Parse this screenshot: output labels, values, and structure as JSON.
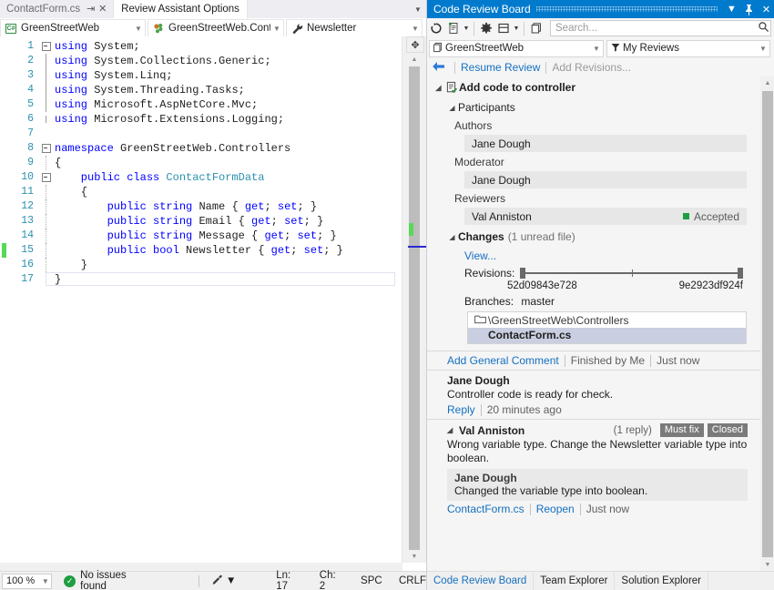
{
  "editor": {
    "tabs": [
      {
        "label": "ContactForm.cs",
        "active": true,
        "pin_icon": "pin-icon",
        "close_icon": "close-icon"
      },
      {
        "label": "Review Assistant Options",
        "active": false
      }
    ],
    "tabstrip_overflow_icon": "chevron-down-icon",
    "navbar": {
      "project": {
        "icon": "csharp-project-icon",
        "badge": "C#",
        "label": "GreenStreetWeb",
        "arrow": "chevron-down-icon"
      },
      "type": {
        "icon": "class-members-icon",
        "label": "GreenStreetWeb.Control",
        "arrow": "chevron-down-icon"
      },
      "member": {
        "icon": "property-wrench-icon",
        "label": "Newsletter",
        "arrow": "chevron-down-icon"
      }
    },
    "lines": [
      {
        "n": "1",
        "fold": "collapse",
        "changed": false,
        "tokens": [
          {
            "t": "using ",
            "c": "kw"
          },
          {
            "t": "System;",
            "c": ""
          }
        ]
      },
      {
        "n": "2",
        "fold": "line",
        "changed": false,
        "tokens": [
          {
            "t": "using ",
            "c": "kw"
          },
          {
            "t": "System.Collections.Generic;",
            "c": ""
          }
        ]
      },
      {
        "n": "3",
        "fold": "line",
        "changed": false,
        "tokens": [
          {
            "t": "using ",
            "c": "kw"
          },
          {
            "t": "System.Linq;",
            "c": ""
          }
        ]
      },
      {
        "n": "4",
        "fold": "line",
        "changed": false,
        "tokens": [
          {
            "t": "using ",
            "c": "kw"
          },
          {
            "t": "System.Threading.Tasks;",
            "c": ""
          }
        ]
      },
      {
        "n": "5",
        "fold": "line",
        "changed": false,
        "tokens": [
          {
            "t": "using ",
            "c": "kw"
          },
          {
            "t": "Microsoft.AspNetCore.Mvc;",
            "c": ""
          }
        ]
      },
      {
        "n": "6",
        "fold": "lineend",
        "changed": false,
        "tokens": [
          {
            "t": "using ",
            "c": "kw"
          },
          {
            "t": "Microsoft.Extensions.Logging;",
            "c": ""
          }
        ]
      },
      {
        "n": "7",
        "fold": "none",
        "changed": false,
        "tokens": []
      },
      {
        "n": "8",
        "fold": "collapse",
        "changed": false,
        "tokens": [
          {
            "t": "namespace ",
            "c": "kw"
          },
          {
            "t": "GreenStreetWeb.Controllers",
            "c": ""
          }
        ]
      },
      {
        "n": "9",
        "fold": "dotted",
        "changed": false,
        "tokens": [
          {
            "t": "{",
            "c": ""
          }
        ]
      },
      {
        "n": "10",
        "fold": "collapse2",
        "changed": false,
        "tokens": [
          {
            "t": "    public class ",
            "c": "kw"
          },
          {
            "t": "ContactFormData",
            "c": "ty"
          }
        ]
      },
      {
        "n": "11",
        "fold": "dotted",
        "changed": false,
        "tokens": [
          {
            "t": "    {",
            "c": ""
          }
        ]
      },
      {
        "n": "12",
        "fold": "dotted2",
        "changed": false,
        "tokens": [
          {
            "t": "        public string ",
            "c": "kw"
          },
          {
            "t": "Name { ",
            "c": ""
          },
          {
            "t": "get",
            "c": "kw"
          },
          {
            "t": "; ",
            "c": ""
          },
          {
            "t": "set",
            "c": "kw"
          },
          {
            "t": "; }",
            "c": ""
          }
        ]
      },
      {
        "n": "13",
        "fold": "dotted2",
        "changed": false,
        "tokens": [
          {
            "t": "        public string ",
            "c": "kw"
          },
          {
            "t": "Email { ",
            "c": ""
          },
          {
            "t": "get",
            "c": "kw"
          },
          {
            "t": "; ",
            "c": ""
          },
          {
            "t": "set",
            "c": "kw"
          },
          {
            "t": "; }",
            "c": ""
          }
        ]
      },
      {
        "n": "14",
        "fold": "dotted2",
        "changed": false,
        "tokens": [
          {
            "t": "        public string ",
            "c": "kw"
          },
          {
            "t": "Message { ",
            "c": ""
          },
          {
            "t": "get",
            "c": "kw"
          },
          {
            "t": "; ",
            "c": ""
          },
          {
            "t": "set",
            "c": "kw"
          },
          {
            "t": "; }",
            "c": ""
          }
        ]
      },
      {
        "n": "15",
        "fold": "dotted2",
        "changed": true,
        "tokens": [
          {
            "t": "        public bool ",
            "c": "kw"
          },
          {
            "t": "Newsletter { ",
            "c": ""
          },
          {
            "t": "get",
            "c": "kw"
          },
          {
            "t": "; ",
            "c": ""
          },
          {
            "t": "set",
            "c": "kw"
          },
          {
            "t": "; }",
            "c": ""
          }
        ]
      },
      {
        "n": "16",
        "fold": "dotted",
        "changed": false,
        "tokens": [
          {
            "t": "    }",
            "c": ""
          }
        ]
      },
      {
        "n": "17",
        "fold": "lineend",
        "changed": false,
        "tokens": [
          {
            "t": "}",
            "c": ""
          }
        ]
      }
    ],
    "split_handle_icon": "split-view-icon",
    "scroll_up_icon": "triangle-up-icon",
    "scroll_down_icon": "triangle-down-icon"
  },
  "status_bar": {
    "zoom": "100 %",
    "zoom_arrow_icon": "chevron-down-icon",
    "issues_icon": "check-circle-icon",
    "issues_text": "No issues found",
    "brush_icon": "brush-icon",
    "brush_arrow_icon": "chevron-down-icon",
    "line": "Ln: 17",
    "column": "Ch: 2",
    "spaces": "SPC",
    "line_ending": "CRLF"
  },
  "review_panel": {
    "title": "Code Review Board",
    "title_buttons": [
      {
        "name": "window-menu-chevron-icon",
        "glyph": "▾"
      },
      {
        "name": "pin-icon",
        "glyph": "⚲"
      },
      {
        "name": "close-icon",
        "glyph": "✕"
      }
    ],
    "toolbar": {
      "refresh_icon": "refresh-icon",
      "new_review_icon": "new-review-icon",
      "new_review_arrow_icon": "chevron-down-icon",
      "settings_icon": "gear-icon",
      "layout_icon": "layout-icon",
      "layout_arrow_icon": "chevron-down-icon",
      "copy_icon": "copy-icon",
      "search_placeholder": "Search...",
      "search_value": "",
      "search_icon": "search-icon"
    },
    "filters": {
      "project": {
        "icon": "solution-icon",
        "label": "GreenStreetWeb",
        "arrow": "chevron-down-icon"
      },
      "scope": {
        "icon": "filter-icon",
        "label": "My Reviews",
        "arrow": "chevron-down-icon"
      }
    },
    "actions": {
      "back_icon": "back-arrow-icon",
      "resume": "Resume Review",
      "add_revisions": "Add Revisions..."
    },
    "review": {
      "title": "Add code to controller",
      "title_icon": "review-accepted-icon",
      "expander_icon": "triangle-expanded-icon",
      "participants": {
        "heading": "Participants",
        "authors_label": "Authors",
        "author": "Jane Dough",
        "moderator_label": "Moderator",
        "moderator": "Jane Dough",
        "reviewers_label": "Reviewers",
        "reviewer": "Val Anniston",
        "reviewer_status": "Accepted",
        "reviewer_status_color": "#1f9d42"
      },
      "changes": {
        "heading": "Changes",
        "note": "(1 unread file)",
        "view_link": "View...",
        "revisions_label": "Revisions:",
        "revision_from": "52d09843e728",
        "revision_to": "9e2923df924f",
        "branches_label": "Branches:",
        "branch": "master",
        "folder": "\\GreenStreetWeb\\Controllers",
        "folder_icon": "folder-icon",
        "file": "ContactForm.cs"
      }
    },
    "comments_bar": {
      "add_link": "Add General Comment",
      "finished": "Finished by Me",
      "time": "Just now"
    },
    "comments": [
      {
        "author": "Jane Dough",
        "body": "Controller code is ready for check.",
        "reply_link": "Reply",
        "time": "20 minutes ago"
      },
      {
        "author": "Val Anniston",
        "expander_icon": "triangle-expanded-icon",
        "replies": "(1 reply)",
        "tags": [
          "Must fix",
          "Closed"
        ],
        "body": "Wrong variable type. Change the Newsletter variable type into boolean.",
        "reply": {
          "author": "Jane Dough",
          "body": "Changed the variable type into boolean."
        },
        "file_link": "ContactForm.cs",
        "reopen_link": "Reopen",
        "time": "Just now"
      }
    ],
    "scroll_up_icon": "triangle-up-icon",
    "scroll_down_icon": "triangle-down-icon",
    "bottom_tabs": [
      {
        "label": "Code Review Board",
        "active": true
      },
      {
        "label": "Team Explorer",
        "active": false
      },
      {
        "label": "Solution Explorer",
        "active": false
      }
    ]
  }
}
